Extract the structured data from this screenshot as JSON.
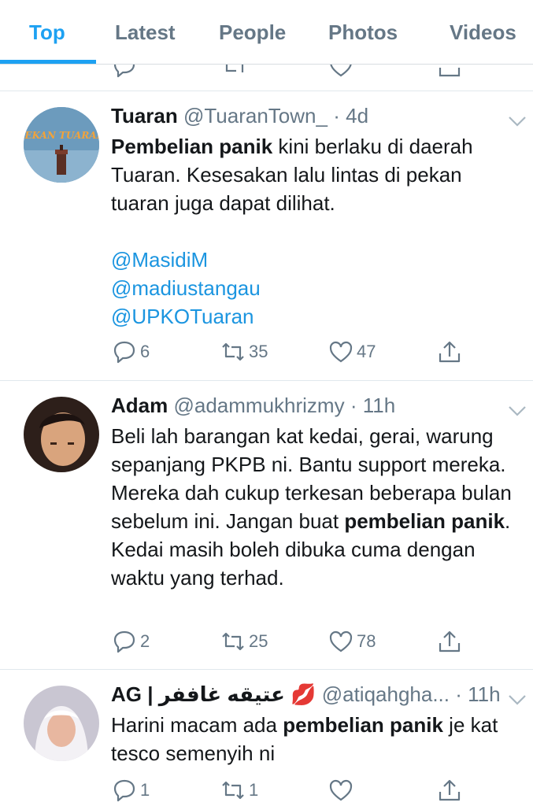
{
  "tabs": [
    {
      "label": "Top",
      "active": true
    },
    {
      "label": "Latest",
      "active": false
    },
    {
      "label": "People",
      "active": false
    },
    {
      "label": "Photos",
      "active": false
    },
    {
      "label": "Videos",
      "active": false
    }
  ],
  "tweets": [
    {
      "name": "Tuaran",
      "handle": "@TuaranTown_",
      "time": "4d",
      "avatar_text": "PEKAN TUARAN",
      "body_lines": {
        "bold": "Pembelian panik",
        "rest": " kini berlaku di daerah Tuaran. Kesesakan lalu lintas di pekan tuaran juga dapat dilihat."
      },
      "mentions": [
        "@MasidiM",
        "@madiustangau",
        "@UPKOTuaran"
      ],
      "replies": "6",
      "retweets": "35",
      "likes": "47"
    },
    {
      "name": "Adam",
      "handle": "@adammukhrizmy",
      "time": "11h",
      "body_pre": "Beli lah barangan kat kedai, gerai, warung sepanjang PKPB ni. Bantu support mereka. Mereka dah cukup terkesan beberapa bulan sebelum ini. Jangan buat ",
      "body_bold": "pembelian panik",
      "body_post": ". Kedai masih boleh dibuka cuma dengan waktu yang terhad.",
      "replies": "2",
      "retweets": "25",
      "likes": "78"
    },
    {
      "name": "AG | عتيقه غاففر 💋",
      "handle": "@atiqahgha...",
      "time": "11h",
      "body_pre": "Harini macam ada ",
      "body_bold": "pembelian panik",
      "body_post": " je kat tesco semenyih ni",
      "replies": "1",
      "retweets": "1",
      "likes": ""
    }
  ],
  "colors": {
    "accent": "#1da1f2",
    "link": "#1b95e0",
    "secondary_text": "#657786"
  },
  "separator_dot": "·"
}
